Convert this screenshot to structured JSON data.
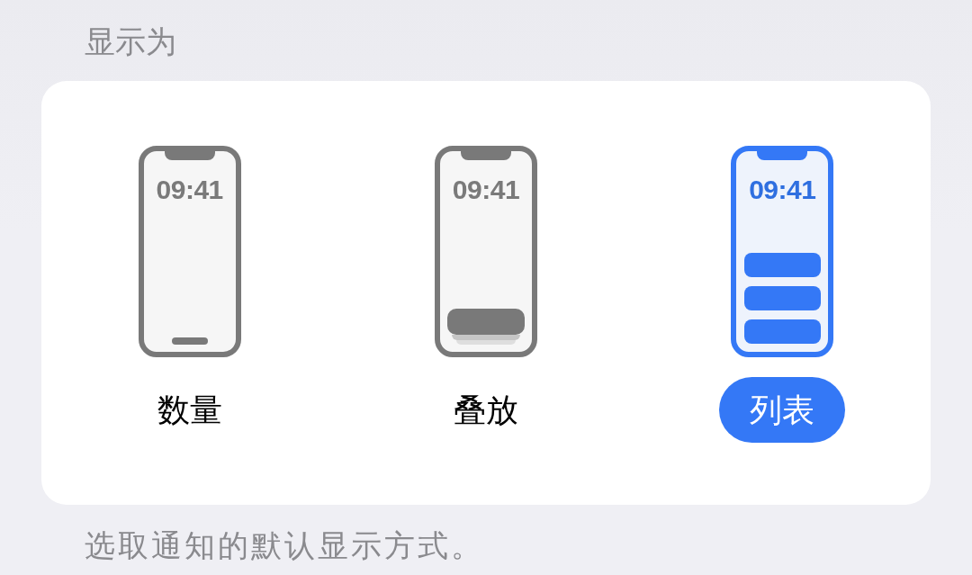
{
  "section_header": "显示为",
  "options": [
    {
      "kind": "count",
      "time": "09:41",
      "label": "数量",
      "selected": false
    },
    {
      "kind": "stack",
      "time": "09:41",
      "label": "叠放",
      "selected": false
    },
    {
      "kind": "list",
      "time": "09:41",
      "label": "列表",
      "selected": true
    }
  ],
  "footer": "选取通知的默认显示方式。"
}
